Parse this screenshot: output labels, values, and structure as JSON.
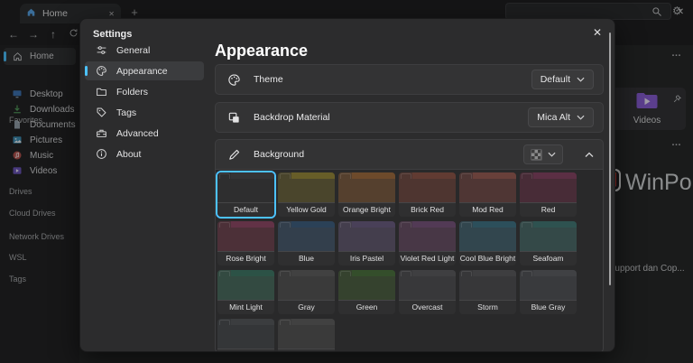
{
  "accent": "#4cc2ff",
  "icons": {
    "new_tab": "+",
    "more": "…",
    "close": "✕",
    "back": "←",
    "forward": "→",
    "up": "↑",
    "gear": "⚙"
  },
  "titlebar": {
    "tab_title": "Home"
  },
  "sidebar": {
    "items": [
      {
        "label": "Home"
      },
      {
        "label": "Desktop"
      },
      {
        "label": "Downloads"
      },
      {
        "label": "Documents"
      },
      {
        "label": "Pictures"
      },
      {
        "label": "Music"
      },
      {
        "label": "Videos"
      }
    ],
    "sections": {
      "favorites": "Favorites",
      "drives": "Drives",
      "cloud_drives": "Cloud Drives",
      "network_drives": "Network Drives",
      "wsl": "WSL",
      "tags": "Tags"
    }
  },
  "content": {
    "videos_tile_label": "Videos",
    "file_label": "Office Support dan Cop...",
    "watermark_text": "WinPoin"
  },
  "settings": {
    "title": "Settings",
    "page_title": "Appearance",
    "nav": [
      {
        "label": "General"
      },
      {
        "label": "Appearance",
        "selected": true
      },
      {
        "label": "Folders"
      },
      {
        "label": "Tags"
      },
      {
        "label": "Advanced"
      },
      {
        "label": "About"
      }
    ],
    "theme_row": {
      "label": "Theme",
      "value": "Default"
    },
    "backdrop_row": {
      "label": "Backdrop Material",
      "value": "Mica Alt"
    },
    "background_row": {
      "label": "Background"
    },
    "swatches": [
      {
        "name": "Default",
        "body": "#2e2e2f",
        "strip": "#343435",
        "selected": true
      },
      {
        "name": "Yellow Gold",
        "body": "#4a452c",
        "strip": "#675d28"
      },
      {
        "name": "Orange Bright",
        "body": "#55402e",
        "strip": "#6d4a2b"
      },
      {
        "name": "Brick Red",
        "body": "#4e3530",
        "strip": "#613b32"
      },
      {
        "name": "Mod Red",
        "body": "#4f3634",
        "strip": "#68403a"
      },
      {
        "name": "Red",
        "body": "#482c37",
        "strip": "#5b2f44"
      },
      {
        "name": "Rose Bright",
        "body": "#4c3038",
        "strip": "#623246"
      },
      {
        "name": "Blue",
        "body": "#333f4c",
        "strip": "#2b4157"
      },
      {
        "name": "Iris Pastel",
        "body": "#443e4d",
        "strip": "#494058"
      },
      {
        "name": "Violet Red Light",
        "body": "#483746",
        "strip": "#523a55"
      },
      {
        "name": "Cool Blue Bright",
        "body": "#32464e",
        "strip": "#2c4f5b"
      },
      {
        "name": "Seafoam",
        "body": "#344948",
        "strip": "#2e5250"
      },
      {
        "name": "Mint Light",
        "body": "#334a41",
        "strip": "#2c5246"
      },
      {
        "name": "Gray",
        "body": "#3a3a3a",
        "strip": "#414141"
      },
      {
        "name": "Green",
        "body": "#35422e",
        "strip": "#344e2b"
      },
      {
        "name": "Overcast",
        "body": "#38383a",
        "strip": "#3f3f41"
      },
      {
        "name": "Storm",
        "body": "#373739",
        "strip": "#3e3e40"
      },
      {
        "name": "Blue Gray",
        "body": "#393a3d",
        "strip": "#404144"
      },
      {
        "name": "",
        "body": "#343638",
        "strip": "#3b3d3f"
      },
      {
        "name": "",
        "body": "#3a3a3a",
        "strip": "#414141"
      }
    ]
  }
}
